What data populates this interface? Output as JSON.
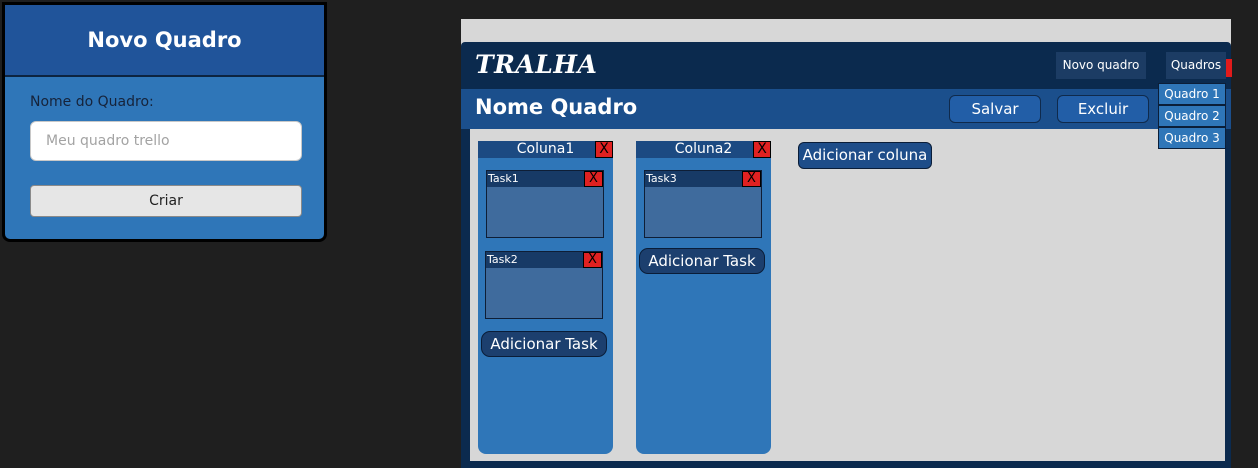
{
  "dialog": {
    "title": "Novo Quadro",
    "label": "Nome do Quadro:",
    "input_placeholder": "Meu quadro trello",
    "input_value": "",
    "create_button": "Criar"
  },
  "app": {
    "logo": "TRALHA",
    "nav": {
      "new_board": "Novo quadro",
      "boards": "Quadros"
    },
    "boards_menu": [
      "Quadro 1",
      "Quadro 2",
      "Quadro 3"
    ],
    "board_title": "Nome Quadro",
    "save_button": "Salvar",
    "delete_button": "Excluir",
    "add_column_button": "Adicionar coluna",
    "columns": [
      {
        "title": "Coluna1",
        "close": "X",
        "tasks": [
          {
            "title": "Task1",
            "close": "X"
          },
          {
            "title": "Task2",
            "close": "X"
          }
        ],
        "add_task": "Adicionar Task"
      },
      {
        "title": "Coluna2",
        "close": "X",
        "tasks": [
          {
            "title": "Task3",
            "close": "X"
          }
        ],
        "add_task": "Adicionar Task"
      }
    ]
  },
  "colors": {
    "navbar": "#0b2a4e",
    "subbar": "#1b4f8c",
    "column": "#2f76b8",
    "close": "#e02121",
    "board_bg": "#d7d7d7"
  }
}
